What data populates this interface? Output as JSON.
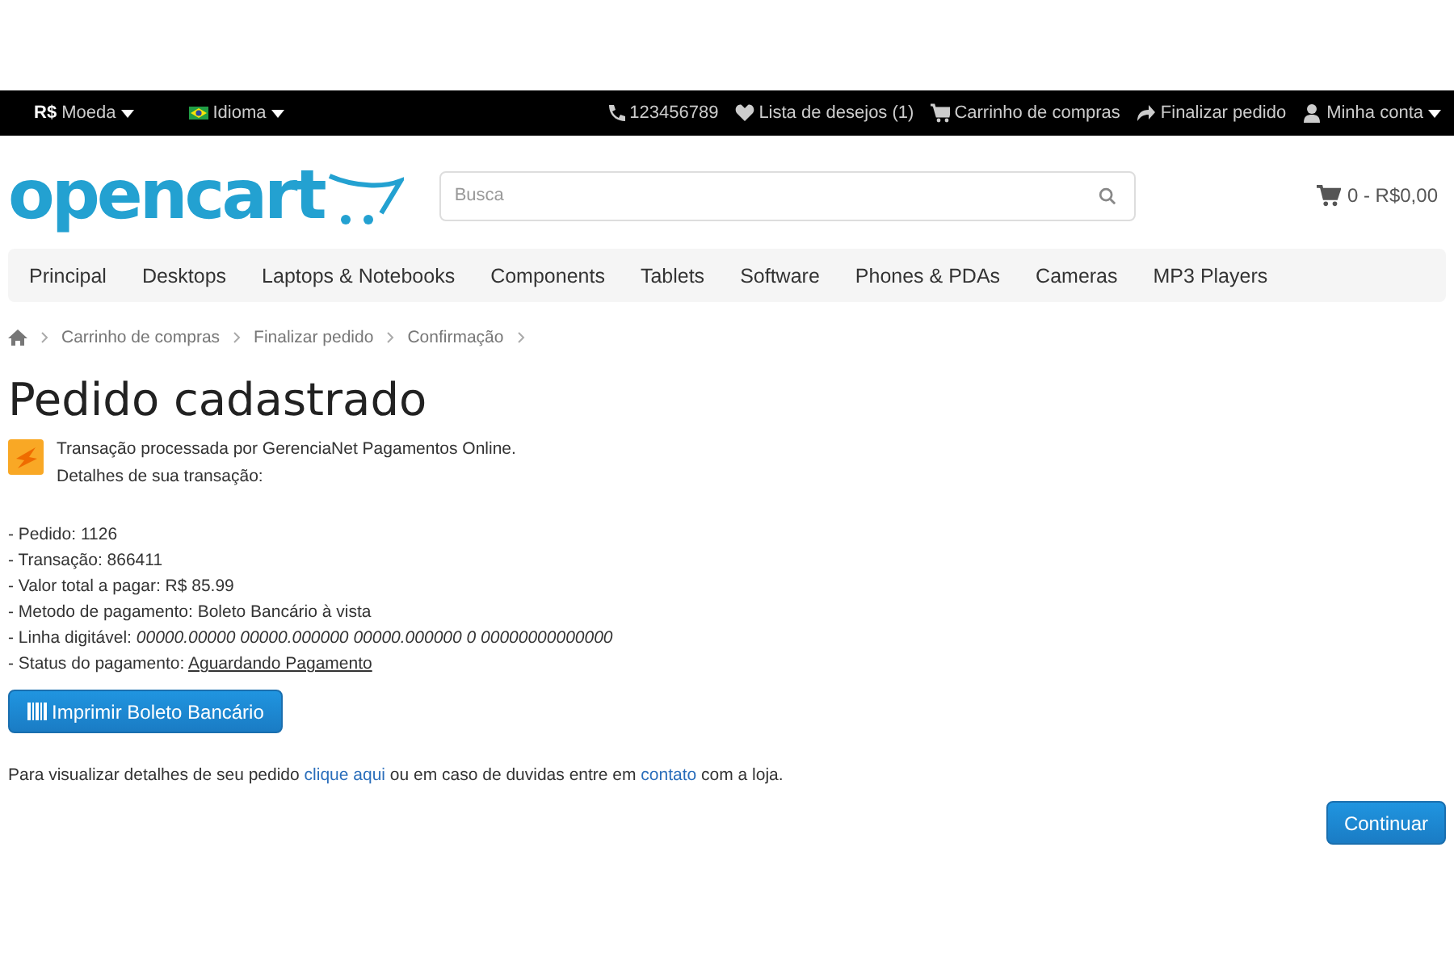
{
  "top_bar": {
    "currency": {
      "symbol": "R$",
      "label": "Moeda"
    },
    "language": {
      "label": "Idioma"
    },
    "links": [
      {
        "kind": "phone",
        "label": "123456789"
      },
      {
        "kind": "wishlist",
        "label": "Lista de desejos (1)"
      },
      {
        "kind": "cart",
        "label": "Carrinho de compras"
      },
      {
        "kind": "checkout",
        "label": "Finalizar pedido"
      },
      {
        "kind": "account",
        "label": "Minha conta",
        "dropdown": true
      }
    ]
  },
  "header": {
    "logo": "opencart",
    "search": {
      "placeholder": "Busca"
    },
    "cart_total": "0 - R$0,00"
  },
  "menu": [
    "Principal",
    "Desktops",
    "Laptops & Notebooks",
    "Components",
    "Tablets",
    "Software",
    "Phones & PDAs",
    "Cameras",
    "MP3 Players"
  ],
  "breadcrumb": [
    "Carrinho de compras",
    "Finalizar pedido",
    "Confirmação"
  ],
  "title": "Pedido cadastrado",
  "notice": [
    "Transação processada por GerenciaNet Pagamentos Online.",
    "Detalhes de sua transação:"
  ],
  "details": [
    {
      "label": "- Pedido: ",
      "value": "1126",
      "kind": "plain"
    },
    {
      "label": "- Transação: ",
      "value": "866411",
      "kind": "plain"
    },
    {
      "label": "- Valor total a pagar: ",
      "value": "R$ 85.99",
      "kind": "plain"
    },
    {
      "label": "- Metodo de pagamento: ",
      "value": "Boleto Bancário à vista",
      "kind": "plain"
    },
    {
      "label": "- Linha digitável: ",
      "value": "00000.00000 00000.000000 00000.000000 0 00000000000000",
      "kind": "italic"
    },
    {
      "label": "- Status do pagamento: ",
      "value": "Aguardando Pagamento",
      "kind": "underline"
    }
  ],
  "print_button": "Imprimir Boleto Bancário",
  "footer_text": {
    "before": "Para visualizar detalhes de seu pedido ",
    "link1": "clique aqui",
    "middle": " ou em caso de duvidas entre em ",
    "link2": "contato",
    "after": " com a loja."
  },
  "continue_button": "Continuar"
}
